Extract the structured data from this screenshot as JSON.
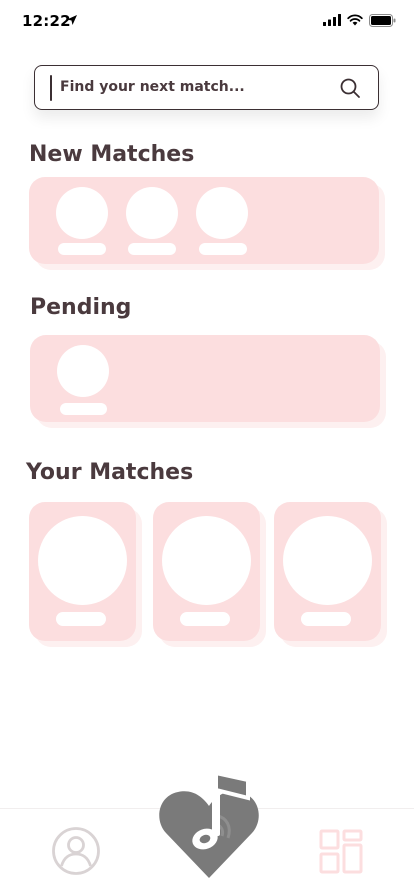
{
  "status_bar": {
    "time": "12:22"
  },
  "search": {
    "placeholder": "Find your next match..."
  },
  "sections": {
    "new_matches": {
      "title": "New Matches"
    },
    "pending": {
      "title": "Pending"
    },
    "your_matches": {
      "title": "Your Matches"
    }
  },
  "colors": {
    "accent_pink": "#fcdedf",
    "text_dark": "#4a3a3e",
    "icon_gray": "#6f6f6f",
    "tab_inactive": "#d9d3d4"
  },
  "tabs": {
    "profile": {
      "icon": "user-circle-icon"
    },
    "center": {
      "icon": "heart-music-icon"
    },
    "matches": {
      "icon": "grid-icon"
    }
  }
}
